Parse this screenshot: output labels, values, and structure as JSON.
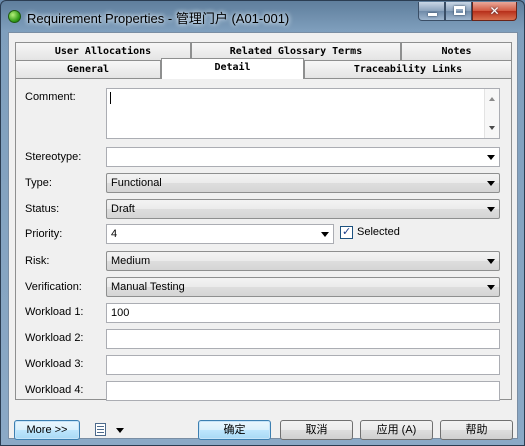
{
  "window": {
    "title": "Requirement Properties - 管理门户 (A01-001)"
  },
  "tabs": {
    "row1": [
      {
        "label": "User Allocations"
      },
      {
        "label": "Related Glossary Terms"
      },
      {
        "label": "Notes"
      }
    ],
    "row2": [
      {
        "label": "General"
      },
      {
        "label": "Detail",
        "active": true
      },
      {
        "label": "Traceability Links"
      }
    ]
  },
  "form": {
    "comment": {
      "label": "Comment:",
      "value": ""
    },
    "stereotype": {
      "label": "Stereotype:",
      "value": ""
    },
    "type": {
      "label": "Type:",
      "value": "Functional"
    },
    "status": {
      "label": "Status:",
      "value": "Draft"
    },
    "priority": {
      "label": "Priority:",
      "value": "4"
    },
    "selected": {
      "label": "Selected",
      "checked": true
    },
    "risk": {
      "label": "Risk:",
      "value": "Medium"
    },
    "verification": {
      "label": "Verification:",
      "value": "Manual Testing"
    },
    "workload1": {
      "label": "Workload 1:",
      "value": "100"
    },
    "workload2": {
      "label": "Workload 2:",
      "value": ""
    },
    "workload3": {
      "label": "Workload 3:",
      "value": ""
    },
    "workload4": {
      "label": "Workload 4:",
      "value": ""
    }
  },
  "buttons": {
    "more": "More >>",
    "ok": "确定",
    "cancel": "取消",
    "apply": "应用 (A)",
    "help": "帮助"
  },
  "icons": {
    "app": "app-icon",
    "document": "document-icon",
    "dropdown": "chevron-down-icon"
  }
}
